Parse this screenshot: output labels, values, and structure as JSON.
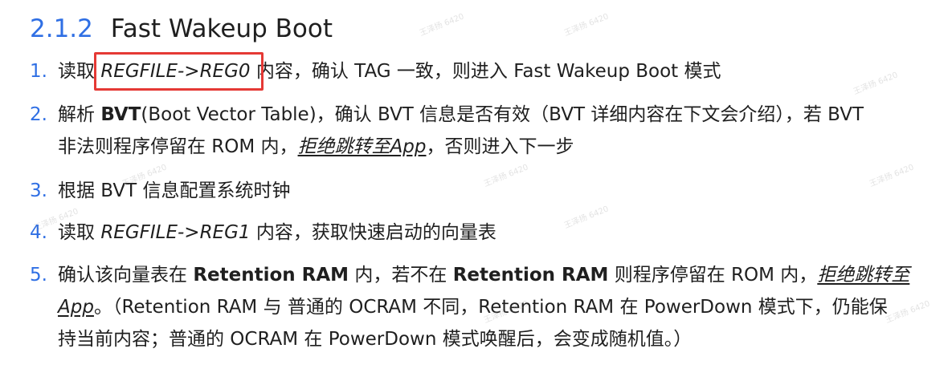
{
  "heading": {
    "number": "2.1.2",
    "title": "Fast Wakeup Boot"
  },
  "items": [
    {
      "marker": "1.",
      "lines": [
        {
          "a": "读取 ",
          "b": "REGFILE->REG0",
          "c": " 内容，确认 TAG 一致，则进入 Fast Wakeup Boot 模式"
        }
      ]
    },
    {
      "marker": "2.",
      "lines": [
        {
          "a": "解析 ",
          "b": "BVT",
          "c": "(Boot Vector Table)，确认 BVT 信息是否有效（BVT 详细内容在下文会介绍），若 BVT"
        },
        {
          "a": "非法则程序停留在 ROM 内，",
          "b": "拒绝跳转至App",
          "c": "，否则进入下一步"
        }
      ]
    },
    {
      "marker": "3.",
      "lines": [
        {
          "a": "根据 BVT 信息配置系统时钟"
        }
      ]
    },
    {
      "marker": "4.",
      "lines": [
        {
          "a": "读取 ",
          "b": "REGFILE->REG1",
          "c": " 内容，获取快速启动的向量表"
        }
      ]
    },
    {
      "marker": "5.",
      "lines": [
        {
          "a": "确认该向量表在 ",
          "b": "Retention RAM",
          "c": " 内，若不在 ",
          "d": "Retention RAM",
          "e": " 则程序停留在 ROM 内，",
          "f": "拒绝跳转至"
        },
        {
          "a": "App",
          "b": "。（Retention RAM 与 普通的 OCRAM 不同，Retention RAM 在 PowerDown 模式下，仍能保"
        },
        {
          "a": "持当前内容；普通的 OCRAM 在 PowerDown 模式唤醒后，会变成随机值。）"
        }
      ]
    }
  ],
  "watermark": "王泽扬 6420"
}
